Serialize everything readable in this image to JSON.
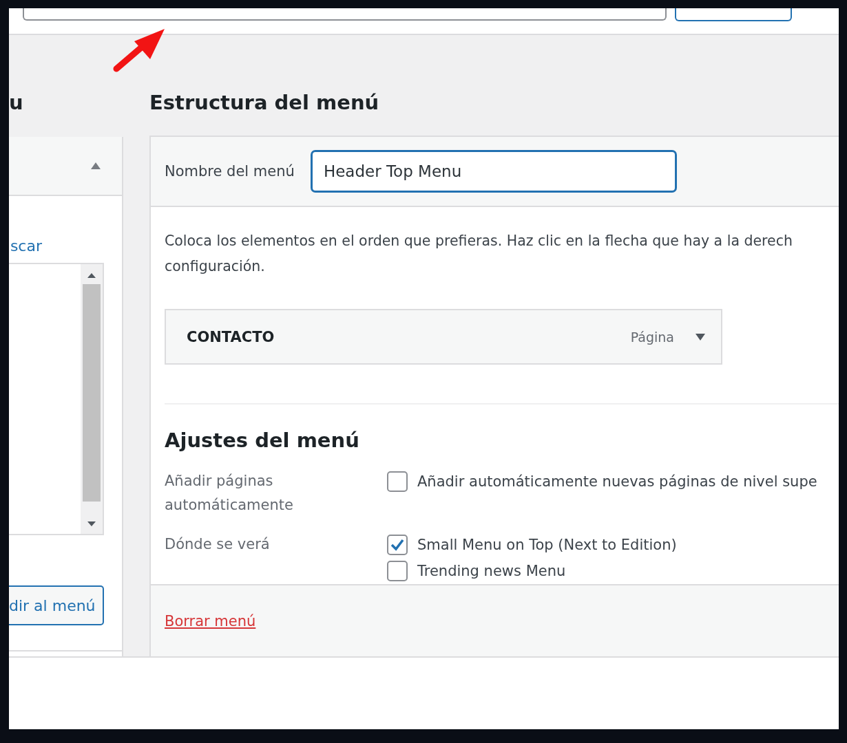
{
  "left_panel": {
    "heading": "u",
    "link": "scar",
    "button": "dir al menú"
  },
  "menu_structure": {
    "title": "Estructura del menú",
    "name_label": "Nombre del menú",
    "name_value": "Header Top Menu",
    "instructions": [
      "Coloca los elementos en el orden que prefieras. Haz clic en la flecha que hay a la derech",
      "configuración."
    ],
    "items": [
      {
        "title": "CONTACTO",
        "type": "Página",
        "expanded": false
      }
    ],
    "settings": {
      "title": "Ajustes del menú",
      "rows": [
        {
          "label": "Añadir páginas automáticamente",
          "options": [
            {
              "label": "Añadir automáticamente nuevas páginas de nivel supe",
              "checked": false
            }
          ]
        },
        {
          "label": "Dónde se verá",
          "options": [
            {
              "label": "Small Menu on Top (Next to Edition)",
              "checked": true
            },
            {
              "label": "Trending news Menu",
              "checked": false
            }
          ]
        }
      ]
    },
    "delete_link": "Borrar menú"
  }
}
